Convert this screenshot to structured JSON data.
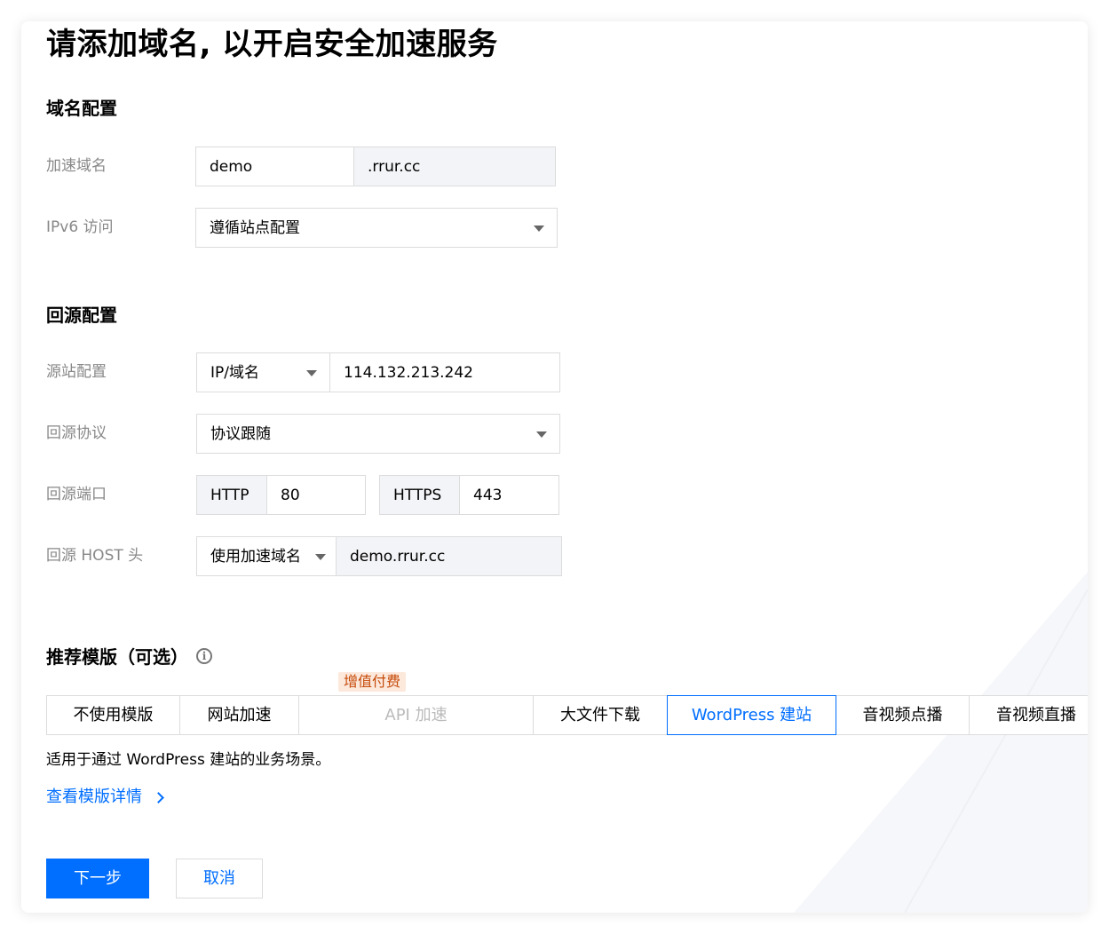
{
  "page_title": "请添加域名, 以开启安全加速服务",
  "domain_section": {
    "title": "域名配置",
    "accel_domain": {
      "label": "加速域名",
      "prefix_value": "demo",
      "suffix": ".rrur.cc"
    },
    "ipv6": {
      "label": "IPv6 访问",
      "selected": "遵循站点配置"
    }
  },
  "origin_section": {
    "title": "回源配置",
    "origin": {
      "label": "源站配置",
      "type_selected": "IP/域名",
      "address": "114.132.213.242"
    },
    "protocol": {
      "label": "回源协议",
      "selected": "协议跟随"
    },
    "port": {
      "label": "回源端口",
      "http_label": "HTTP",
      "http_value": "80",
      "https_label": "HTTPS",
      "https_value": "443"
    },
    "host": {
      "label": "回源 HOST 头",
      "selected": "使用加速域名",
      "value": "demo.rrur.cc"
    }
  },
  "template_section": {
    "title": "推荐模版（可选）",
    "info_icon": "info-circle-icon",
    "badge": "增值付费",
    "tabs": [
      {
        "label": "不使用模版"
      },
      {
        "label": "网站加速"
      },
      {
        "label": "API 加速"
      },
      {
        "label": "大文件下载"
      },
      {
        "label": "WordPress 建站"
      },
      {
        "label": "音视频点播"
      },
      {
        "label": "音视频直播"
      }
    ],
    "active_tab": "WordPress 建站",
    "disabled_tab": "API 加速",
    "description": "适用于通过 WordPress 建站的业务场景。",
    "detail_link": "查看模版详情"
  },
  "actions": {
    "next": "下一步",
    "cancel": "取消"
  },
  "colors": {
    "accent": "#006eff",
    "badge_bg": "#fde8dc",
    "badge_text": "#c54b0a"
  }
}
